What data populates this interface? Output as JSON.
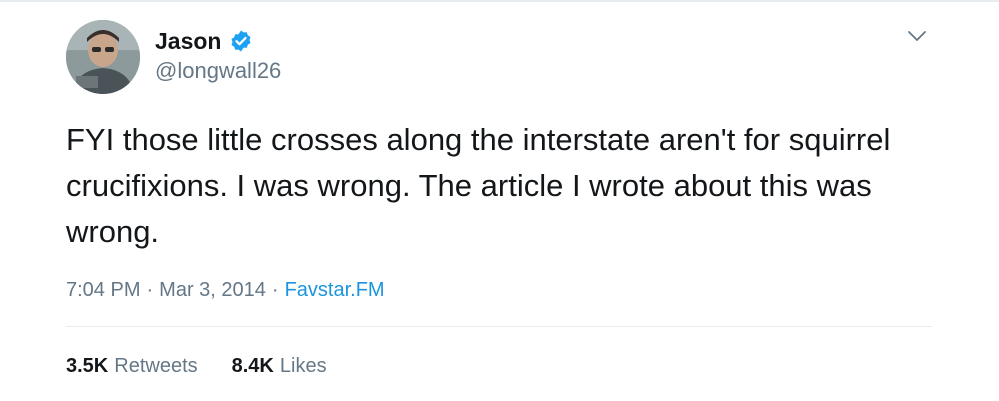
{
  "user": {
    "name": "Jason",
    "handle": "@longwall26",
    "avatar_icon": "avatar-photo",
    "verified_icon": "verified-badge-icon"
  },
  "tweet": {
    "text": "FYI those little crosses along the interstate aren't for squirrel crucifixions. I was wrong. The article I wrote about this was wrong.",
    "time": "7:04 PM",
    "date": "Mar 3, 2014",
    "separator": "·",
    "source": "Favstar.FM"
  },
  "stats": {
    "retweets_count": "3.5K",
    "retweets_label": "Retweets",
    "likes_count": "8.4K",
    "likes_label": "Likes"
  },
  "colors": {
    "text": "#14171a",
    "secondary": "#657786",
    "link": "#1b95e0",
    "verified": "#1da1f2",
    "divider": "#e6ecf0"
  },
  "icons": {
    "menu": "chevron-down-icon"
  }
}
